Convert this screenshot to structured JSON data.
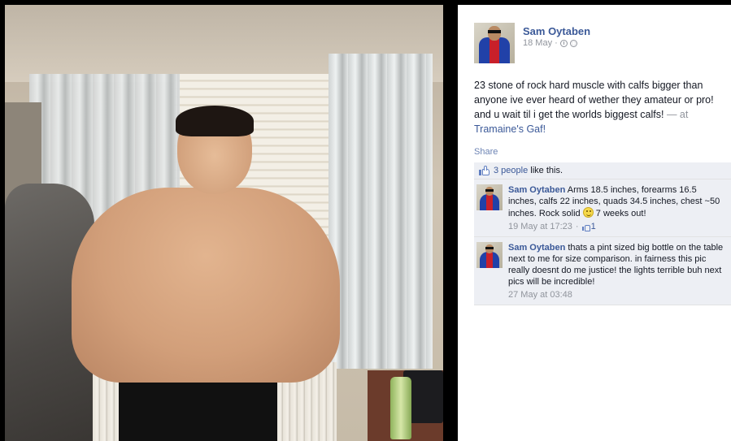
{
  "post": {
    "author": "Sam Oytaben",
    "date": "18 May",
    "text": "23 stone of rock hard muscle with calfs bigger than anyone ive ever heard of wether they amateur or pro! and u wait til i get the worlds biggest calfs!",
    "at_prefix": " — at ",
    "place": "Tramaine's Gaf!",
    "share_label": "Share"
  },
  "likes": {
    "link_text": "3 people",
    "suffix": " like this."
  },
  "comments": [
    {
      "author": "Sam Oytaben",
      "text_before": " Arms 18.5 inches, forearms 16.5 inches, calfs 22 inches, quads 34.5 inches, chest ~50 inches. Rock solid ",
      "text_after": " 7 weeks out!",
      "timestamp": "19 May at 17:23",
      "sep": " · ",
      "like_count": "1"
    },
    {
      "author": "Sam Oytaben",
      "text": " thats a pint sized big bottle on the table next to me for size comparison. in fairness this pic really doesnt do me justice! the lights terrible buh next pics will be incredible!",
      "timestamp": "27 May at 03:48"
    }
  ],
  "icons": {
    "meta": [
      "clock-icon",
      "globe-icon"
    ],
    "likes": "like-thumb-icon",
    "emoticon": "smiley-icon"
  },
  "colors": {
    "link": "#3b5998",
    "meta": "#90949c",
    "ufi_background": "#edeff4"
  }
}
